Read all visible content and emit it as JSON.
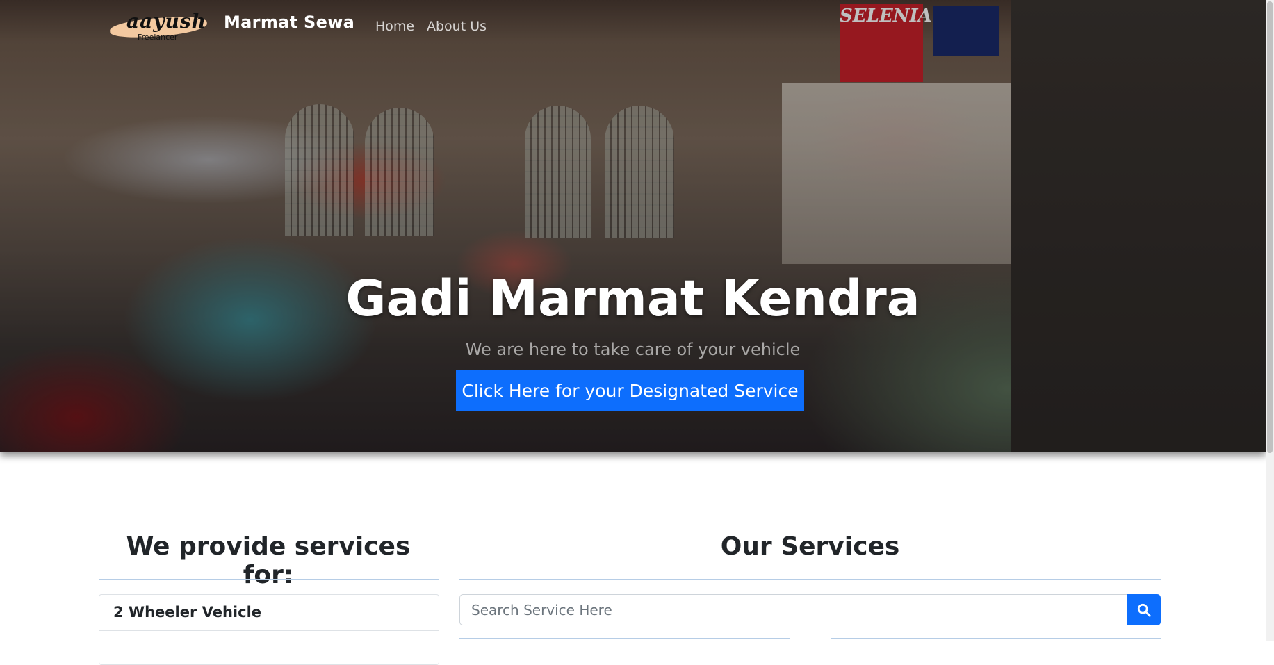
{
  "navbar": {
    "logo_text": "aayush",
    "logo_subtext": "Freelancer",
    "brand": "Marmat Sewa",
    "links": [
      {
        "label": "Home"
      },
      {
        "label": "About Us"
      }
    ]
  },
  "hero": {
    "title": "Gadi Marmat Kendra",
    "subtitle": "We are here to take care of your vehicle",
    "cta_label": "Click Here for your Designated Service",
    "background_sign": "SELENIA"
  },
  "vehicles": {
    "heading": "We provide services for:",
    "items": [
      {
        "label": "2 Wheeler Vehicle"
      }
    ]
  },
  "services": {
    "heading": "Our Services",
    "search": {
      "placeholder": "Search Service Here",
      "value": ""
    },
    "search_icon": "search-icon"
  },
  "colors": {
    "primary": "#0d6efd",
    "divider": "#b6cde6",
    "text": "#212529"
  }
}
